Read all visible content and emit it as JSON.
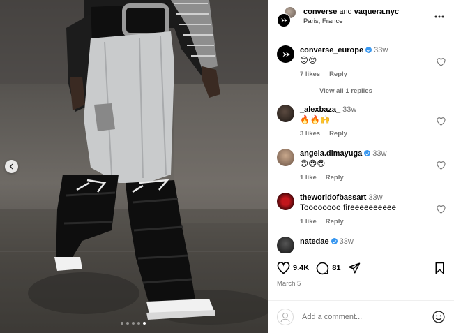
{
  "header": {
    "account_1": "converse",
    "joiner": "and",
    "account_2": "vaquera.nyc",
    "location": "Paris, France"
  },
  "media": {
    "slide_count": 5,
    "active_slide": 5
  },
  "comments": [
    {
      "username": "converse_europe",
      "verified": true,
      "time": "33w",
      "text": "😍😍",
      "likes": "7 likes",
      "reply": "Reply",
      "avatar": "converse-logo-icon"
    },
    {
      "username": "_alexbaza_",
      "verified": false,
      "time": "33w",
      "text": "🔥🔥🙌",
      "likes": "3 likes",
      "reply": "Reply",
      "avatar": "user-photo-avatar"
    },
    {
      "username": "angela.dimayuga",
      "verified": true,
      "time": "33w",
      "text": "😍😍😍",
      "likes": "1 like",
      "reply": "Reply",
      "avatar": "user-photo-avatar"
    },
    {
      "username": "theworldofbassart",
      "verified": false,
      "time": "33w",
      "text": "Toooooooo fireeeeeeeeee",
      "likes": "1 like",
      "reply": "Reply",
      "avatar": "user-photo-avatar"
    },
    {
      "username": "natedae",
      "verified": true,
      "time": "33w",
      "text": "",
      "likes": "",
      "reply": "",
      "avatar": "user-photo-avatar"
    }
  ],
  "view_replies": "View all 1 replies",
  "actions": {
    "likes_count": "9.4K",
    "comments_count": "81",
    "date": "March 5"
  },
  "add_comment": {
    "placeholder": "Add a comment..."
  },
  "colors": {
    "verified": "#3897f0",
    "muted_text": "#737373",
    "divider": "#efefef"
  }
}
